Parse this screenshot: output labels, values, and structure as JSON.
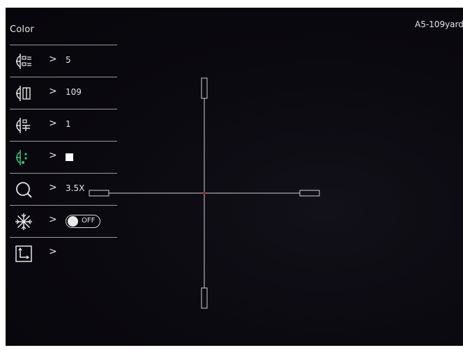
{
  "header": {
    "title": "Color",
    "info": "A5-109yard"
  },
  "menu": {
    "items": [
      {
        "icon": "distance-list-icon",
        "value": "5"
      },
      {
        "icon": "distance-set-icon",
        "value": "109"
      },
      {
        "icon": "distance-adjust-icon",
        "value": "1"
      },
      {
        "icon": "reticle-color-icon",
        "value": ""
      },
      {
        "icon": "zoom-icon",
        "value": "3.5X"
      },
      {
        "icon": "snowflake-icon",
        "value": "OFF"
      },
      {
        "icon": "position-icon",
        "value": ""
      }
    ],
    "arrow": ">",
    "reticle_color": "#ffffff",
    "accent_color": "#36c97a"
  },
  "reticle": {
    "center_color": "#d01515"
  }
}
